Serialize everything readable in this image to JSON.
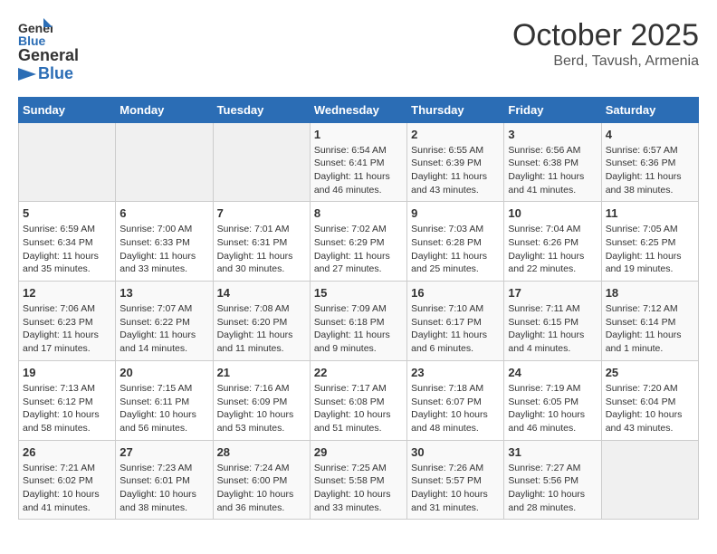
{
  "header": {
    "logo_line1": "General",
    "logo_line2": "Blue",
    "title": "October 2025",
    "subtitle": "Berd, Tavush, Armenia"
  },
  "calendar": {
    "days_of_week": [
      "Sunday",
      "Monday",
      "Tuesday",
      "Wednesday",
      "Thursday",
      "Friday",
      "Saturday"
    ],
    "weeks": [
      [
        {
          "day": "",
          "info": ""
        },
        {
          "day": "",
          "info": ""
        },
        {
          "day": "",
          "info": ""
        },
        {
          "day": "1",
          "info": "Sunrise: 6:54 AM\nSunset: 6:41 PM\nDaylight: 11 hours and 46 minutes."
        },
        {
          "day": "2",
          "info": "Sunrise: 6:55 AM\nSunset: 6:39 PM\nDaylight: 11 hours and 43 minutes."
        },
        {
          "day": "3",
          "info": "Sunrise: 6:56 AM\nSunset: 6:38 PM\nDaylight: 11 hours and 41 minutes."
        },
        {
          "day": "4",
          "info": "Sunrise: 6:57 AM\nSunset: 6:36 PM\nDaylight: 11 hours and 38 minutes."
        }
      ],
      [
        {
          "day": "5",
          "info": "Sunrise: 6:59 AM\nSunset: 6:34 PM\nDaylight: 11 hours and 35 minutes."
        },
        {
          "day": "6",
          "info": "Sunrise: 7:00 AM\nSunset: 6:33 PM\nDaylight: 11 hours and 33 minutes."
        },
        {
          "day": "7",
          "info": "Sunrise: 7:01 AM\nSunset: 6:31 PM\nDaylight: 11 hours and 30 minutes."
        },
        {
          "day": "8",
          "info": "Sunrise: 7:02 AM\nSunset: 6:29 PM\nDaylight: 11 hours and 27 minutes."
        },
        {
          "day": "9",
          "info": "Sunrise: 7:03 AM\nSunset: 6:28 PM\nDaylight: 11 hours and 25 minutes."
        },
        {
          "day": "10",
          "info": "Sunrise: 7:04 AM\nSunset: 6:26 PM\nDaylight: 11 hours and 22 minutes."
        },
        {
          "day": "11",
          "info": "Sunrise: 7:05 AM\nSunset: 6:25 PM\nDaylight: 11 hours and 19 minutes."
        }
      ],
      [
        {
          "day": "12",
          "info": "Sunrise: 7:06 AM\nSunset: 6:23 PM\nDaylight: 11 hours and 17 minutes."
        },
        {
          "day": "13",
          "info": "Sunrise: 7:07 AM\nSunset: 6:22 PM\nDaylight: 11 hours and 14 minutes."
        },
        {
          "day": "14",
          "info": "Sunrise: 7:08 AM\nSunset: 6:20 PM\nDaylight: 11 hours and 11 minutes."
        },
        {
          "day": "15",
          "info": "Sunrise: 7:09 AM\nSunset: 6:18 PM\nDaylight: 11 hours and 9 minutes."
        },
        {
          "day": "16",
          "info": "Sunrise: 7:10 AM\nSunset: 6:17 PM\nDaylight: 11 hours and 6 minutes."
        },
        {
          "day": "17",
          "info": "Sunrise: 7:11 AM\nSunset: 6:15 PM\nDaylight: 11 hours and 4 minutes."
        },
        {
          "day": "18",
          "info": "Sunrise: 7:12 AM\nSunset: 6:14 PM\nDaylight: 11 hours and 1 minute."
        }
      ],
      [
        {
          "day": "19",
          "info": "Sunrise: 7:13 AM\nSunset: 6:12 PM\nDaylight: 10 hours and 58 minutes."
        },
        {
          "day": "20",
          "info": "Sunrise: 7:15 AM\nSunset: 6:11 PM\nDaylight: 10 hours and 56 minutes."
        },
        {
          "day": "21",
          "info": "Sunrise: 7:16 AM\nSunset: 6:09 PM\nDaylight: 10 hours and 53 minutes."
        },
        {
          "day": "22",
          "info": "Sunrise: 7:17 AM\nSunset: 6:08 PM\nDaylight: 10 hours and 51 minutes."
        },
        {
          "day": "23",
          "info": "Sunrise: 7:18 AM\nSunset: 6:07 PM\nDaylight: 10 hours and 48 minutes."
        },
        {
          "day": "24",
          "info": "Sunrise: 7:19 AM\nSunset: 6:05 PM\nDaylight: 10 hours and 46 minutes."
        },
        {
          "day": "25",
          "info": "Sunrise: 7:20 AM\nSunset: 6:04 PM\nDaylight: 10 hours and 43 minutes."
        }
      ],
      [
        {
          "day": "26",
          "info": "Sunrise: 7:21 AM\nSunset: 6:02 PM\nDaylight: 10 hours and 41 minutes."
        },
        {
          "day": "27",
          "info": "Sunrise: 7:23 AM\nSunset: 6:01 PM\nDaylight: 10 hours and 38 minutes."
        },
        {
          "day": "28",
          "info": "Sunrise: 7:24 AM\nSunset: 6:00 PM\nDaylight: 10 hours and 36 minutes."
        },
        {
          "day": "29",
          "info": "Sunrise: 7:25 AM\nSunset: 5:58 PM\nDaylight: 10 hours and 33 minutes."
        },
        {
          "day": "30",
          "info": "Sunrise: 7:26 AM\nSunset: 5:57 PM\nDaylight: 10 hours and 31 minutes."
        },
        {
          "day": "31",
          "info": "Sunrise: 7:27 AM\nSunset: 5:56 PM\nDaylight: 10 hours and 28 minutes."
        },
        {
          "day": "",
          "info": ""
        }
      ]
    ]
  }
}
